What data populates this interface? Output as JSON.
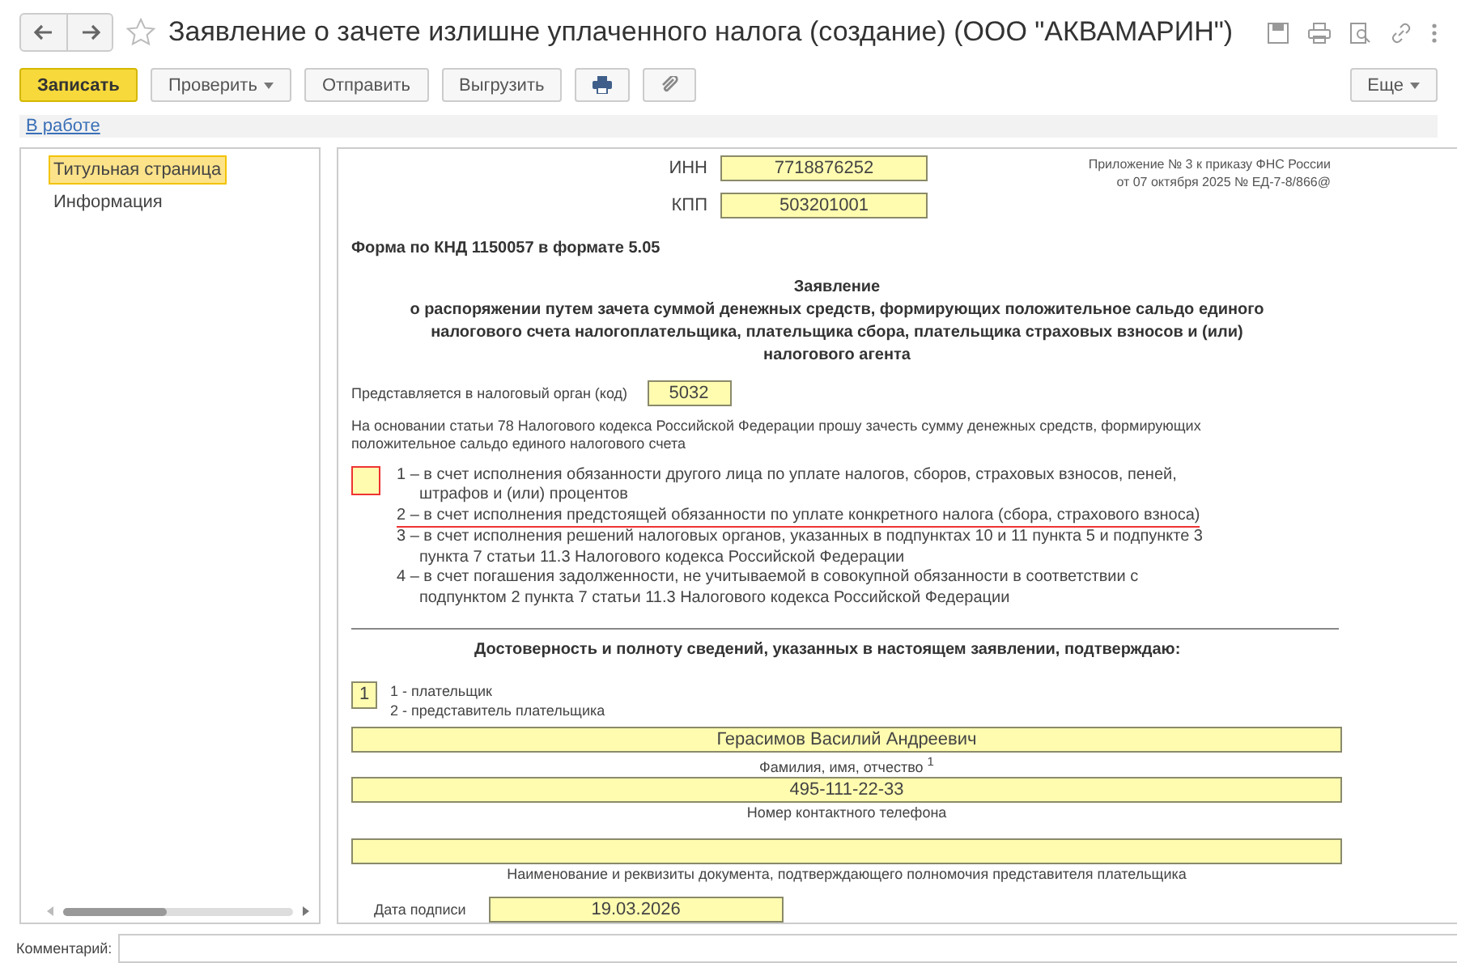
{
  "window": {
    "title": "Заявление о зачете излишне уплаченного налога (создание) (ООО \"АКВАМАРИН\")",
    "favorite": false
  },
  "toolbar": {
    "buttons": [
      {
        "kind": "primary",
        "label": "Записать"
      },
      {
        "kind": "dropdown",
        "label": "Проверить"
      },
      {
        "kind": "plain",
        "label": "Отправить"
      },
      {
        "kind": "plain",
        "label": "Выгрузить"
      },
      {
        "kind": "print"
      },
      {
        "kind": "attach"
      }
    ],
    "more": "Еще"
  },
  "status_link": "В работе",
  "sidebar": {
    "items": [
      {
        "label": "Титульная страница",
        "selected": true
      },
      {
        "label": "Информация",
        "selected": false
      }
    ]
  },
  "form": {
    "inn": {
      "label": "ИНН",
      "value": "7718876252"
    },
    "kpp": {
      "label": "КПП",
      "value": "503201001"
    },
    "appendix": [
      "Приложение № 3 к приказу ФНС России",
      "от 07 октября 2025 № ЕД-7-8/866@"
    ],
    "form_code": "Форма по КНД 1150057 в формате 5.05",
    "heading": "Заявление",
    "subheading": "о распоряжении путем зачета суммой денежных средств, формирующих положительное сальдо единого налогового счета налогоплательщика, плательщика сбора, плательщика страховых взносов и (или) налогового агента",
    "authority": {
      "label": "Представляется в налоговый орган (код)",
      "value": "5032"
    },
    "basis": "На основании статьи 78 Налогового кодекса Российской Федерации прошу зачесть сумму денежных средств, формирующих положительное сальдо единого налогового счета",
    "option_code": {
      "invalid": true
    },
    "options": [
      {
        "text": "1 – в счет исполнения обязанности другого лица по уплате налогов, сборов, страховых взносов, пеней, штрафов и (или) процентов",
        "underlined": false
      },
      {
        "text": "2 – в счет исполнения предстоящей обязанности по уплате конкретного налога (сбора, страхового взноса)",
        "underlined": true
      },
      {
        "text": "3 – в счет исполнения решений налоговых органов, указанных в подпунктах 10 и 11 пункта 5 и подпункте 3 пункта 7 статьи 11.3 Налогового кодекса Российской Федерации",
        "underlined": false
      },
      {
        "text": "4 – в счет погашения задолженности, не учитываемой в совокупной обязанности в соответствии с подпунктом 2 пункта 7 статьи 11.3 Налогового кодекса Российской Федерации",
        "underlined": false
      }
    ],
    "confirm_title": "Достоверность и полноту сведений, указанных в настоящем заявлении, подтверждаю:",
    "signer_code": "1",
    "signer_options": [
      "1 - плательщик",
      "2 - представитель плательщика"
    ],
    "fio": {
      "value": "Герасимов Василий Андреевич",
      "caption": "Фамилия, имя, отчество $^{1}$"
    },
    "phone": {
      "value": "495-111-22-33",
      "caption": "Номер контактного телефона"
    },
    "document": {
      "caption": "Наименование и реквизиты документа, подтверждающего полномочия представителя плательщика"
    },
    "sign_date": {
      "label": "Дата подписи",
      "value": "19.03.2026"
    }
  },
  "comment": {
    "label": "Комментарий:"
  }
}
